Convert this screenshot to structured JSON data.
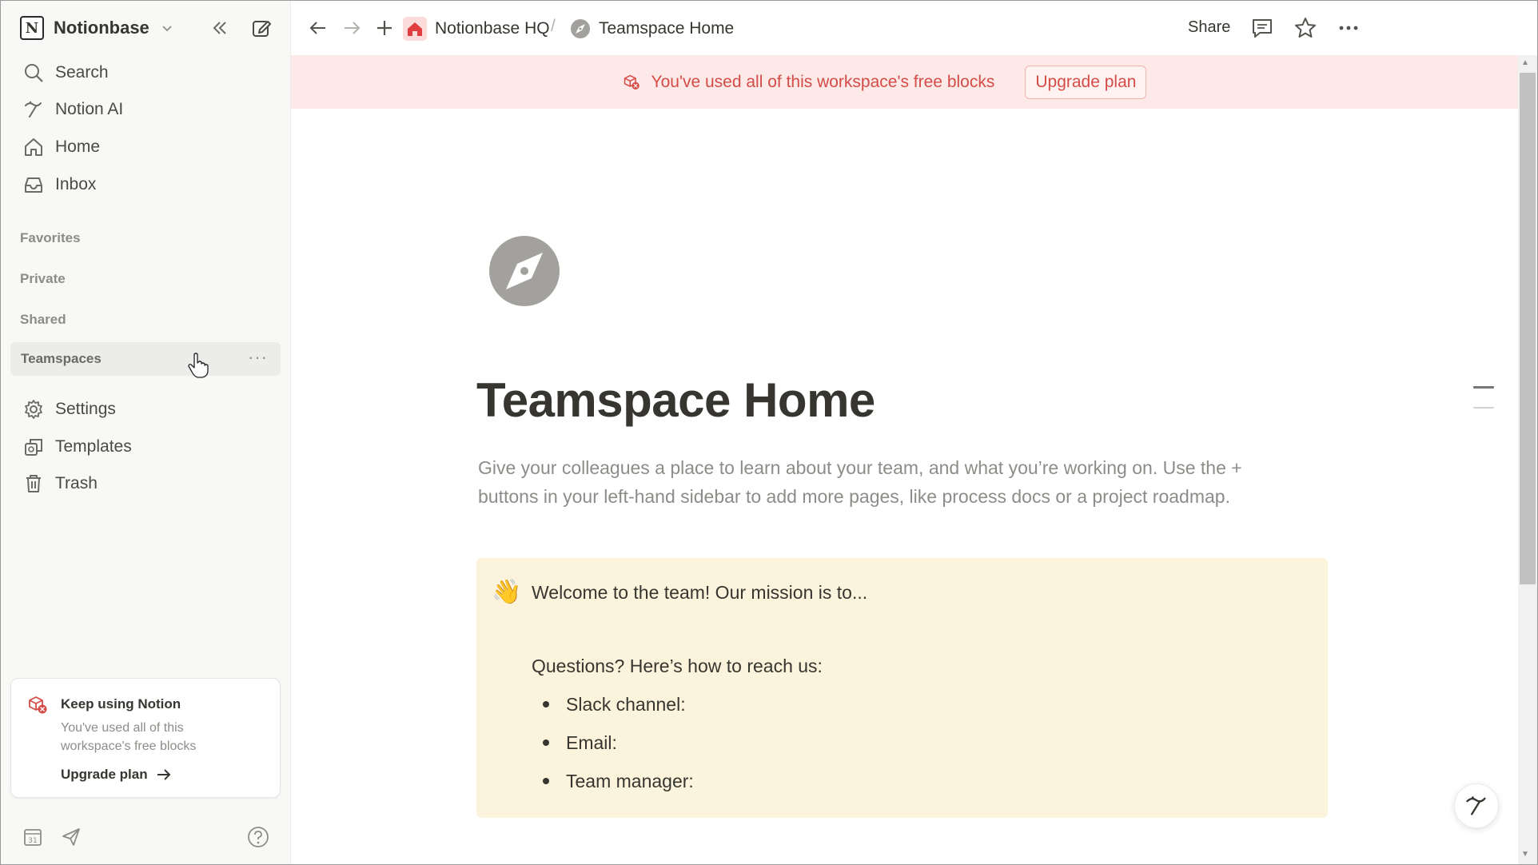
{
  "sidebar": {
    "workspace_name": "Notionbase",
    "workspace_logo": "N",
    "nav": [
      {
        "label": "Search",
        "icon": "search-icon"
      },
      {
        "label": "Notion AI",
        "icon": "notion-ai-icon"
      },
      {
        "label": "Home",
        "icon": "home-icon"
      },
      {
        "label": "Inbox",
        "icon": "inbox-icon"
      }
    ],
    "sections": {
      "favorites": "Favorites",
      "private": "Private",
      "shared": "Shared",
      "teamspaces": "Teamspaces"
    },
    "bottom_nav": [
      {
        "label": "Settings",
        "icon": "gear-icon"
      },
      {
        "label": "Templates",
        "icon": "templates-icon"
      },
      {
        "label": "Trash",
        "icon": "trash-icon"
      }
    ],
    "upgrade_card": {
      "title": "Keep using Notion",
      "body": "You've used all of this workspace's free blocks",
      "link": "Upgrade plan"
    },
    "calendar_day": "31"
  },
  "topbar": {
    "breadcrumb_workspace": "Notionbase HQ",
    "breadcrumb_separator": "/",
    "breadcrumb_page": "Teamspace Home",
    "share_label": "Share"
  },
  "banner": {
    "text": "You've used all of this workspace's free blocks",
    "button": "Upgrade plan",
    "color": "#d44c47",
    "background": "#fde9e8"
  },
  "page": {
    "icon": "compass-icon",
    "title": "Teamspace Home",
    "description": "Give your colleagues a place to learn about your team, and what you’re working on. Use the + buttons in your left-hand sidebar to add more pages, like process docs or a project roadmap.",
    "callout": {
      "emoji": "👋",
      "title": "Welcome to the team! Our mission is to...",
      "question": "Questions? Here’s how to reach us:",
      "items": [
        "Slack channel:",
        "Email:",
        "Team manager:"
      ],
      "background": "#fbf3db"
    }
  }
}
